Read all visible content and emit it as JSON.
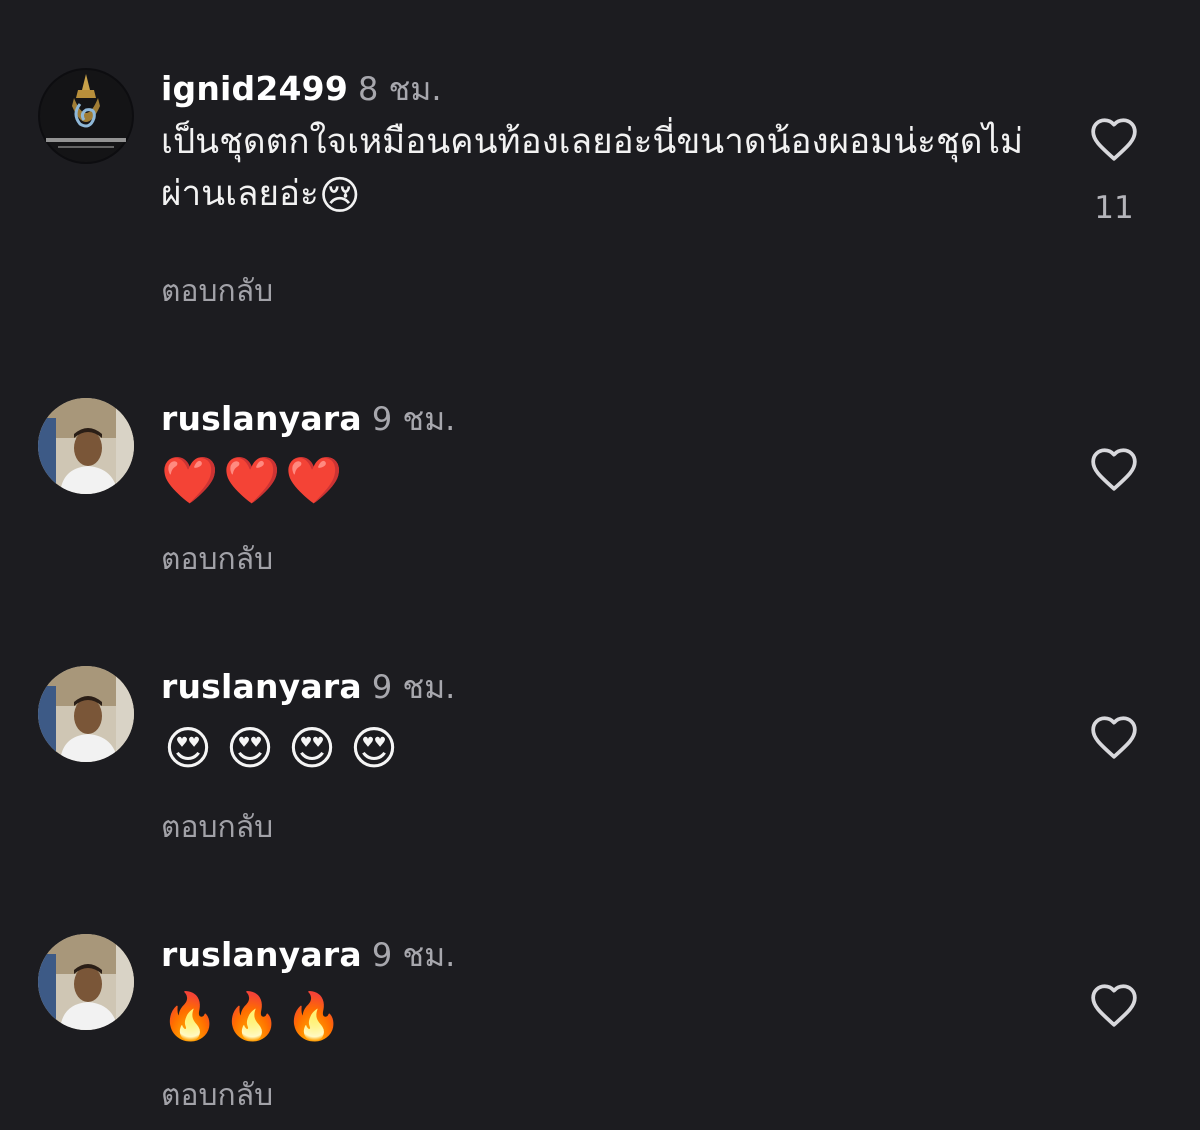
{
  "comments": [
    {
      "username": "ignid2499",
      "time": "8 ชม.",
      "text": "เป็นชุดตกใจเหมือนคนท้องเลยอ่ะนี่ขนาดน้องผอมน่ะชุดไม่ผ่านเลยอ่ะ",
      "text_emoji": "😢",
      "reply_label": "ตอบกลับ",
      "like_count": "11",
      "avatar_icon": "temple-logo-icon"
    },
    {
      "username": "ruslanyara",
      "time": "9 ชม.",
      "emojis": [
        "❤️",
        "❤️",
        "❤️"
      ],
      "reply_label": "ตอบกลับ",
      "avatar_icon": "user-photo-icon"
    },
    {
      "username": "ruslanyara",
      "time": "9 ชม.",
      "emojis": [
        "😍",
        "😍",
        "😍",
        "😍"
      ],
      "reply_label": "ตอบกลับ",
      "avatar_icon": "user-photo-icon"
    },
    {
      "username": "ruslanyara",
      "time": "9 ชม.",
      "emojis": [
        "🔥",
        "🔥",
        "🔥"
      ],
      "reply_label": "ตอบกลับ",
      "avatar_icon": "user-photo-icon"
    }
  ],
  "colors": {
    "background": "#1c1c20",
    "username": "#ffffff",
    "secondary_text": "#a7a7ad",
    "heart_outline": "#d8d8dc"
  }
}
